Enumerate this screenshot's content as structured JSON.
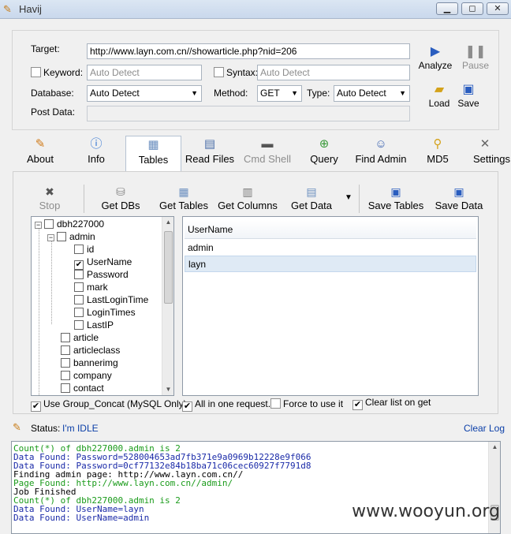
{
  "window": {
    "title": "Havij",
    "minimize": "▭",
    "maximize": "◻",
    "close": "✕"
  },
  "target": {
    "target_label": "Target:",
    "target_value": "http://www.layn.com.cn//showarticle.php?nid=206",
    "keyword_label": "Keyword:",
    "keyword_placeholder": "Auto Detect",
    "syntax_label": "Syntax:",
    "syntax_placeholder": "Auto Detect",
    "database_label": "Database:",
    "database_value": "Auto Detect",
    "method_label": "Method:",
    "method_value": "GET",
    "type_label": "Type:",
    "type_value": "Auto Detect",
    "postdata_label": "Post Data:",
    "postdata_value": ""
  },
  "actions": {
    "analyze": "Analyze",
    "pause": "Pause",
    "load": "Load",
    "save": "Save"
  },
  "tabs": [
    {
      "label": "About",
      "icon": "pen-icon"
    },
    {
      "label": "Info",
      "icon": "info-icon"
    },
    {
      "label": "Tables",
      "icon": "table-icon"
    },
    {
      "label": "Read Files",
      "icon": "file-icon"
    },
    {
      "label": "Cmd Shell",
      "icon": "console-icon"
    },
    {
      "label": "Query",
      "icon": "query-icon"
    },
    {
      "label": "Find Admin",
      "icon": "users-icon"
    },
    {
      "label": "MD5",
      "icon": "wrench-icon"
    },
    {
      "label": "Settings",
      "icon": "tools-icon"
    }
  ],
  "active_tab": "Tables",
  "toolbar": {
    "stop": "Stop",
    "get_dbs": "Get DBs",
    "get_tables": "Get Tables",
    "get_columns": "Get Columns",
    "get_data": "Get Data",
    "save_tables": "Save Tables",
    "save_data": "Save Data"
  },
  "tree": {
    "db": "dbh227000",
    "table_admin": "admin",
    "columns": [
      "id",
      "UserName",
      "Password",
      "mark",
      "LastLoginTime",
      "LoginTimes",
      "LastIP"
    ],
    "checked_column": "UserName",
    "tables": [
      "article",
      "articleclass",
      "bannerimg",
      "company",
      "contact"
    ]
  },
  "grid": {
    "header": "UserName",
    "rows": [
      "admin",
      "layn"
    ],
    "selected_row": "layn"
  },
  "options": {
    "group_concat": "Use Group_Concat (MySQL Only)",
    "all_in_one": "All in one request.",
    "force": "Force to use it",
    "clear_list": "Clear list on get"
  },
  "status": {
    "label": "Status:",
    "value": "I'm IDLE",
    "clear_log": "Clear Log"
  },
  "log": [
    {
      "text": "Count(*) of dbh227000.admin is 2",
      "color": "#1a9b1a"
    },
    {
      "text": "Data Found: Password=528004653ad7fb371e9a0969b12228e9f066",
      "color": "#1a2aa8"
    },
    {
      "text": "Data Found: Password=0cf77132e84b18ba71c06cec60927f7791d8",
      "color": "#1a2aa8"
    },
    {
      "text": "Finding admin page: http://www.layn.com.cn//",
      "color": "#000000"
    },
    {
      "text": "Page Found: http://www.layn.com.cn//admin/",
      "color": "#1a9b1a"
    },
    {
      "text": "Job Finished",
      "color": "#000000"
    },
    {
      "text": "Count(*) of dbh227000.admin is 2",
      "color": "#1a9b1a"
    },
    {
      "text": "Data Found: UserName=layn",
      "color": "#1a2aa8"
    },
    {
      "text": "Data Found: UserName=admin",
      "color": "#1a2aa8"
    }
  ],
  "watermark": "www.wooyun.org"
}
